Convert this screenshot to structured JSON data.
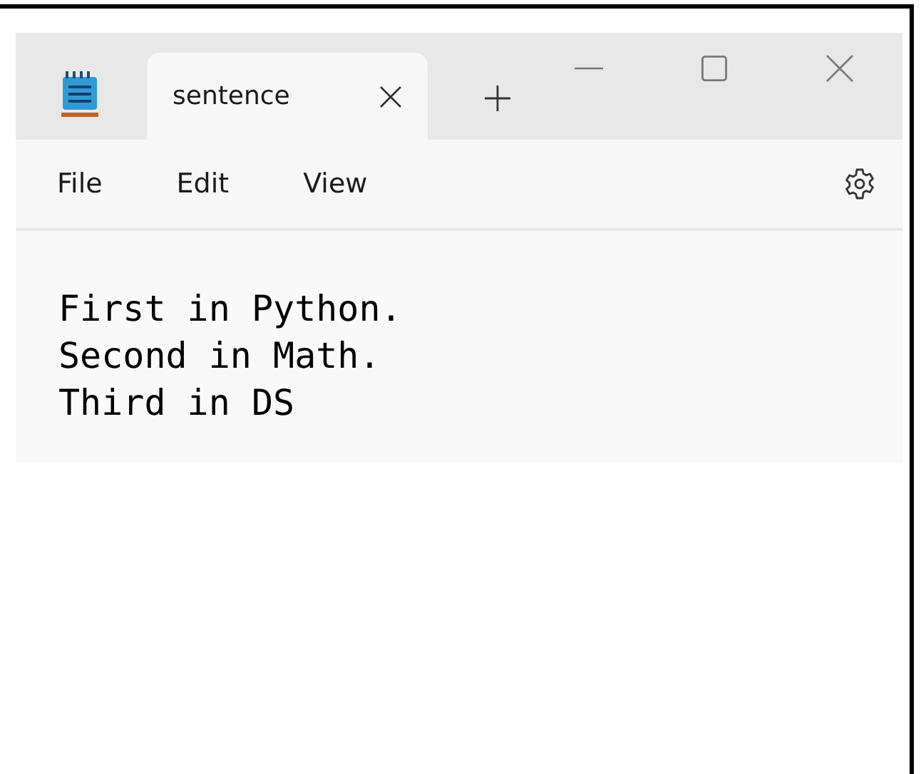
{
  "tabs": [
    {
      "label": "sentence",
      "selected": true
    }
  ],
  "menu": [
    "File",
    "Edit",
    "View"
  ],
  "document": {
    "lines": [
      "First in Python.",
      "Second in Math.",
      "Third in DS"
    ]
  }
}
